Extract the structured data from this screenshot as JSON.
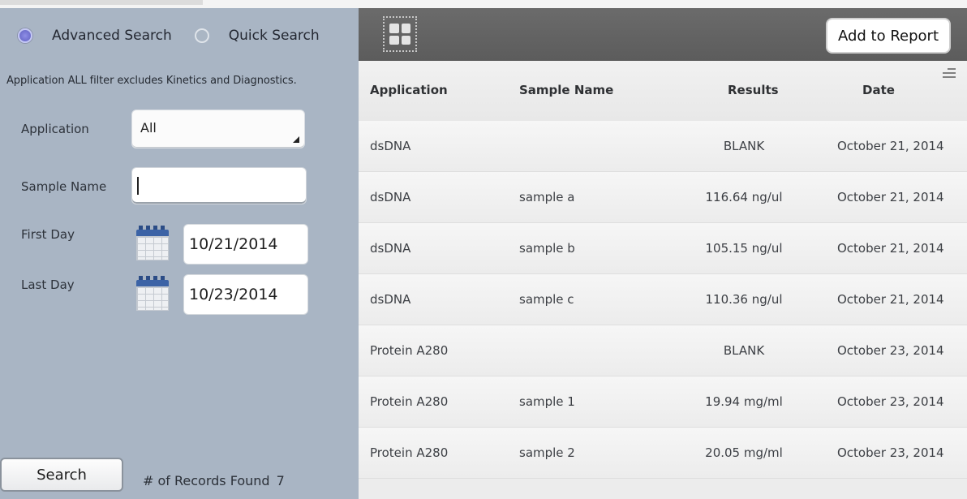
{
  "search_panel": {
    "modes": [
      {
        "label": "Advanced Search",
        "selected": true
      },
      {
        "label": "Quick Search",
        "selected": false
      }
    ],
    "notice": "Application ALL filter excludes Kinetics and Diagnostics.",
    "application": {
      "label": "Application",
      "value": "All"
    },
    "sample_name": {
      "label": "Sample Name",
      "value": ""
    },
    "first_day": {
      "label": "First Day",
      "value": "10/21/2014"
    },
    "last_day": {
      "label": "Last Day",
      "value": "10/23/2014"
    },
    "search_button": "Search",
    "records_label": "# of Records Found",
    "records_count": "7"
  },
  "toolbar": {
    "grid_icon": "grid-view-icon",
    "add_button": "Add to Report"
  },
  "table": {
    "columns": [
      "Application",
      "Sample Name",
      "Results",
      "Date"
    ],
    "rows": [
      {
        "application": "dsDNA",
        "sample_name": "",
        "results": "BLANK",
        "date": "October 21, 2014"
      },
      {
        "application": "dsDNA",
        "sample_name": "sample a",
        "results": "116.64 ng/ul",
        "date": "October 21, 2014"
      },
      {
        "application": "dsDNA",
        "sample_name": "sample b",
        "results": "105.15 ng/ul",
        "date": "October 21, 2014"
      },
      {
        "application": "dsDNA",
        "sample_name": "sample c",
        "results": "110.36 ng/ul",
        "date": "October 21, 2014"
      },
      {
        "application": "Protein A280",
        "sample_name": "",
        "results": "BLANK",
        "date": "October 23, 2014"
      },
      {
        "application": "Protein A280",
        "sample_name": "sample 1",
        "results": "19.94 mg/ml",
        "date": "October 23, 2014"
      },
      {
        "application": "Protein A280",
        "sample_name": "sample 2",
        "results": "20.05 mg/ml",
        "date": "October 23, 2014"
      }
    ]
  },
  "colors": {
    "left_panel": "#a9b5c4",
    "toolbar": "#636363",
    "selected_radio": "#7474d2"
  }
}
